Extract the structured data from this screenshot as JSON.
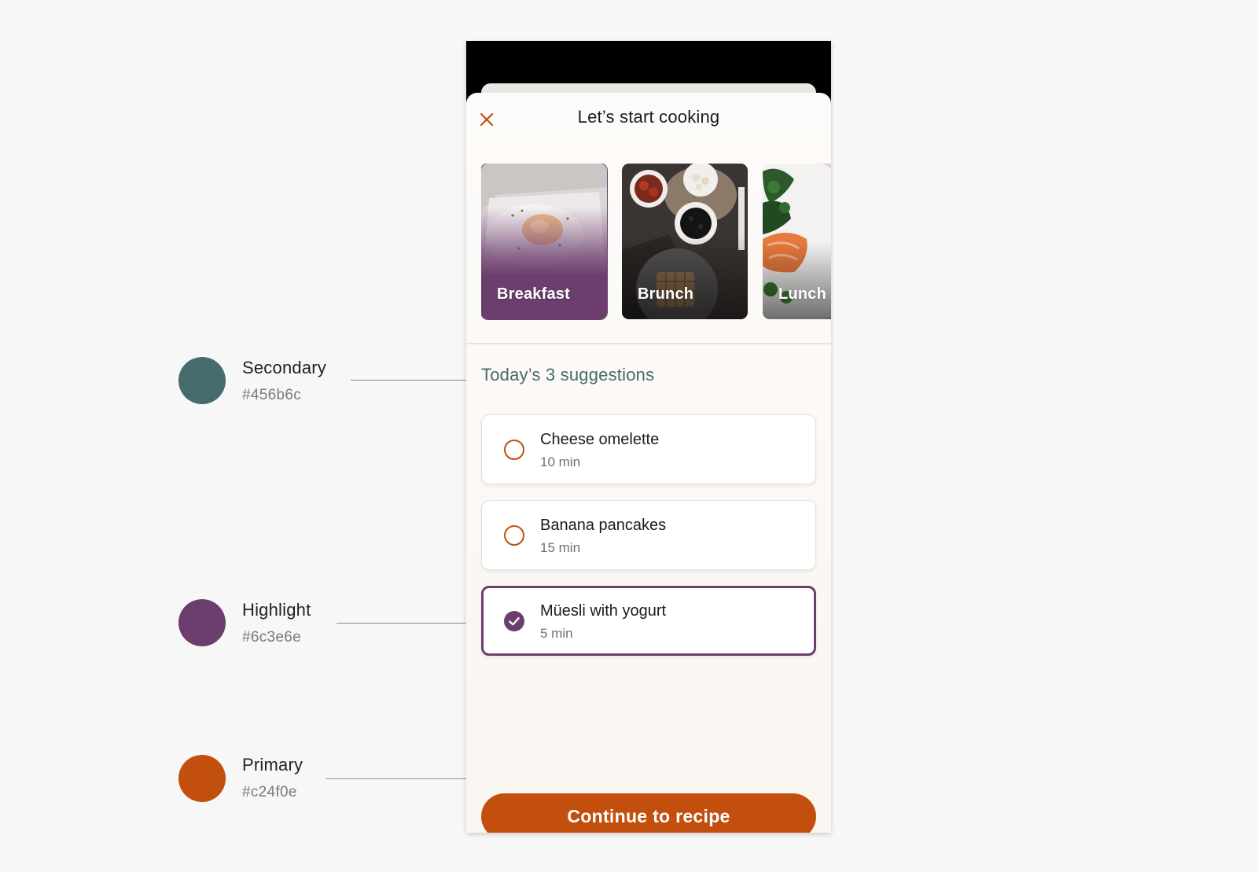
{
  "legend": [
    {
      "name": "Secondary",
      "hex_label": "#456b6c",
      "color": "#456b6c"
    },
    {
      "name": "Highlight",
      "hex_label": "#6c3e6e",
      "color": "#6c3e6e"
    },
    {
      "name": "Primary",
      "hex_label": "#c24f0e",
      "color": "#c24f0e"
    }
  ],
  "sheet": {
    "title": "Let’s start cooking",
    "close_icon": "close-x-icon"
  },
  "categories": [
    {
      "label": "Breakfast",
      "selected": true
    },
    {
      "label": "Brunch",
      "selected": false
    },
    {
      "label": "Lunch",
      "selected": false
    }
  ],
  "suggestions": {
    "heading": "Today’s 3 suggestions",
    "items": [
      {
        "name": "Cheese omelette",
        "time": "10 min",
        "selected": false
      },
      {
        "name": "Banana pancakes",
        "time": "15 min",
        "selected": false
      },
      {
        "name": "Müesli with yogurt",
        "time": "5 min",
        "selected": true
      }
    ]
  },
  "cta": {
    "label": "Continue to recipe"
  },
  "colors": {
    "secondary": "#456b6c",
    "highlight": "#6c3e6e",
    "primary": "#c24f0e"
  }
}
